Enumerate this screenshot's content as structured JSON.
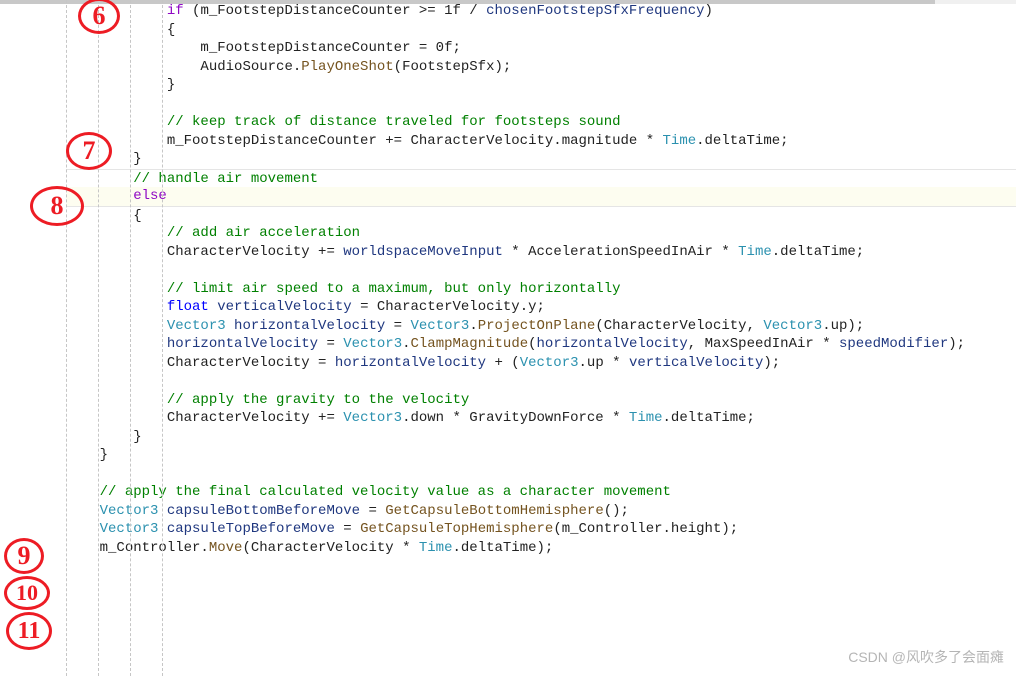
{
  "annotations": {
    "a6": "6",
    "a7": "7",
    "a8": "8",
    "a9": "9",
    "a10": "10",
    "a11": "11"
  },
  "watermark": "CSDN @风吹多了会面瘫",
  "code": {
    "l1_if": "if",
    "l1_a": " (m_FootstepDistanceCounter >= 1f / ",
    "l1_b": "chosenFootstepSfxFrequency",
    "l1_c": ")",
    "l2": "{",
    "l3": "    m_FootstepDistanceCounter = 0f;",
    "l4_a": "    AudioSource.",
    "l4_m": "PlayOneShot",
    "l4_b": "(FootstepSfx);",
    "l5": "}",
    "l6": "",
    "l7_c": "// keep track of distance traveled for footsteps sound",
    "l8_a": "m_FootstepDistanceCounter += CharacterVelocity.magnitude * ",
    "l8_t": "Time",
    "l8_b": ".deltaTime;",
    "l9": "}",
    "l10_c": "// handle air movement",
    "l11_else": "else",
    "l12": "{",
    "l13_c": "    // add air acceleration",
    "l14_a": "    CharacterVelocity += ",
    "l14_p": "worldspaceMoveInput",
    "l14_b": " * AccelerationSpeedInAir * ",
    "l14_t": "Time",
    "l14_c2": ".deltaTime;",
    "l15": "",
    "l16_c": "    // limit air speed to a maximum, but only horizontally",
    "l17_kw": "    float",
    "l17_a": " ",
    "l17_p": "verticalVelocity",
    "l17_b": " = CharacterVelocity.y;",
    "l18_t1": "    Vector3",
    "l18_sp": " ",
    "l18_p": "horizontalVelocity",
    "l18_eq": " = ",
    "l18_t2": "Vector3",
    "l18_dot": ".",
    "l18_m": "ProjectOnPlane",
    "l18_b": "(CharacterVelocity, ",
    "l18_t3": "Vector3",
    "l18_c2": ".up);",
    "l19_p": "    horizontalVelocity",
    "l19_eq": " = ",
    "l19_t": "Vector3",
    "l19_dot": ".",
    "l19_m": "ClampMagnitude",
    "l19_a": "(",
    "l19_p2": "horizontalVelocity",
    "l19_b": ", MaxSpeedInAir * ",
    "l19_p3": "speedModifier",
    "l19_c2": ");",
    "l20_a": "    CharacterVelocity = ",
    "l20_p": "horizontalVelocity",
    "l20_b": " + (",
    "l20_t": "Vector3",
    "l20_c2": ".up * ",
    "l20_p2": "verticalVelocity",
    "l20_d": ");",
    "l21": "",
    "l22_c": "    // apply the gravity to the velocity",
    "l23_a": "    CharacterVelocity += ",
    "l23_t": "Vector3",
    "l23_b": ".down * GravityDownForce * ",
    "l23_t2": "Time",
    "l23_c2": ".deltaTime;",
    "l24": "}",
    "l25": "}",
    "l26": "",
    "l27_c": "// apply the final calculated velocity value as a character movement",
    "l28_t": "Vector3",
    "l28_sp": " ",
    "l28_p": "capsuleBottomBeforeMove",
    "l28_eq": " = ",
    "l28_m": "GetCapsuleBottomHemisphere",
    "l28_b": "();",
    "l29_t": "Vector3",
    "l29_sp": " ",
    "l29_p": "capsuleTopBeforeMove",
    "l29_eq": " = ",
    "l29_m": "GetCapsuleTopHemisphere",
    "l29_b": "(m_Controller.height);",
    "l30_a": "m_Controller.",
    "l30_m": "Move",
    "l30_b": "(CharacterVelocity * ",
    "l30_t": "Time",
    "l30_c2": ".deltaTime);"
  }
}
